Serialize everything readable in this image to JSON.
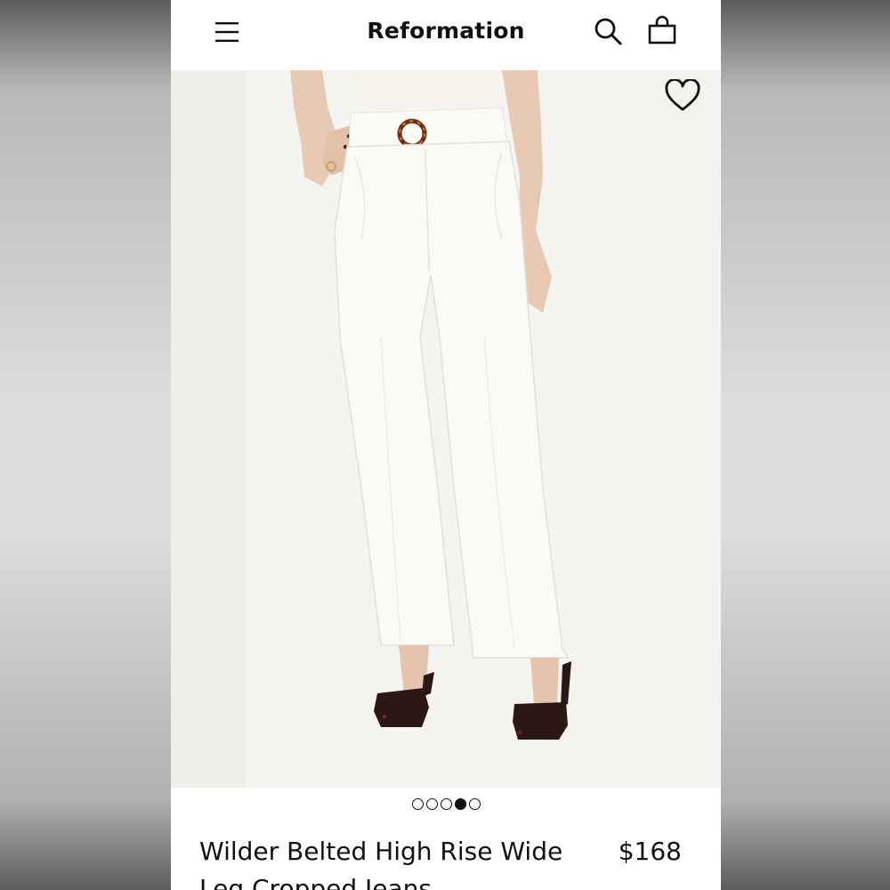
{
  "header": {
    "brand": "Reformation",
    "menu_icon": "hamburger-menu-icon",
    "search_icon": "search-icon",
    "bag_icon": "shopping-bag-icon"
  },
  "gallery": {
    "wishlist_icon": "heart-icon",
    "image_count": 5,
    "active_index": 3
  },
  "product": {
    "title": "Wilder Belted High Rise Wide Leg Cropped Jeans",
    "price": "$168"
  },
  "colors": {
    "text": "#111111",
    "background": "#ffffff",
    "image_backdrop": "#f3f2ee",
    "jeans": "#f8f7f2",
    "sandals": "#2b1714"
  }
}
